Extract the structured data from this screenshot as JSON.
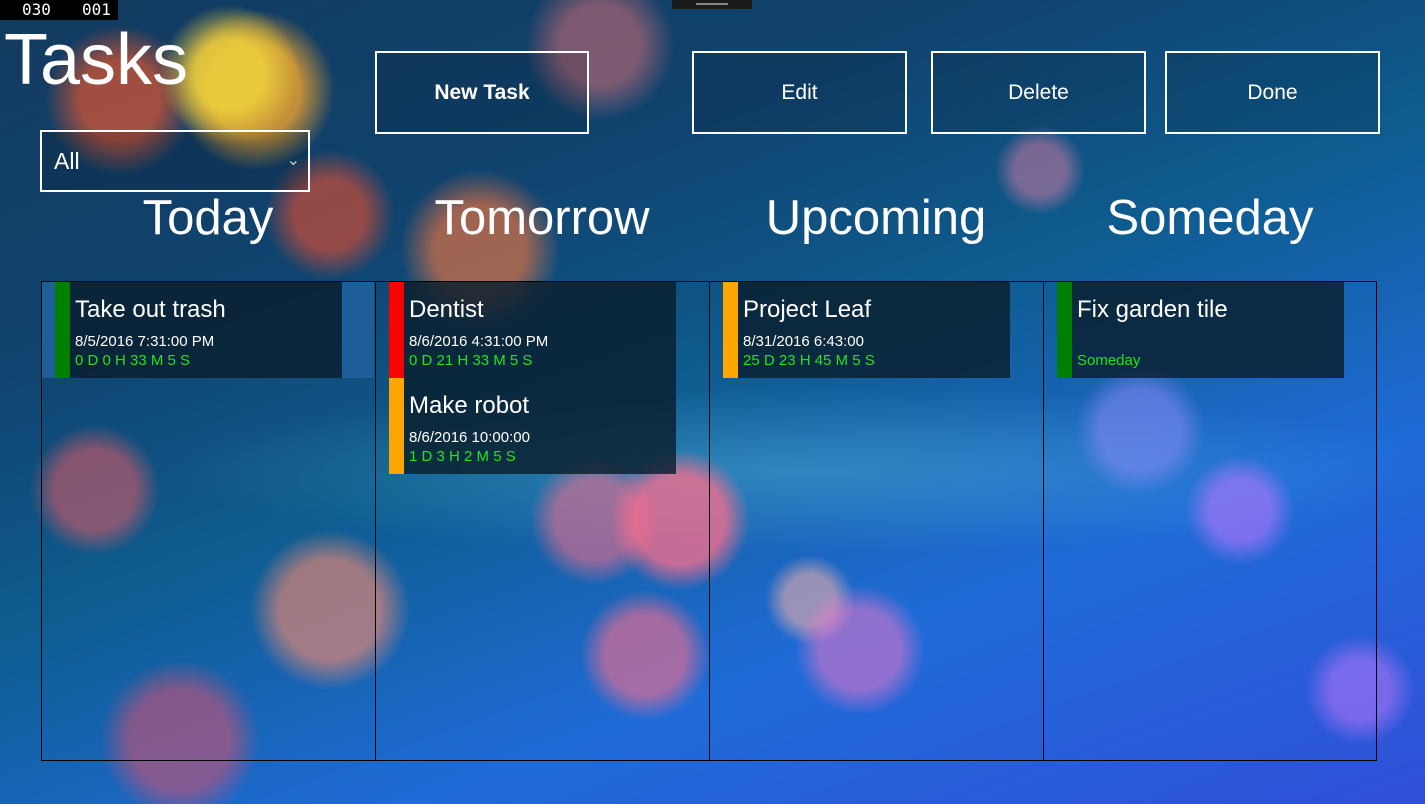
{
  "debug": {
    "counter_left": "030",
    "counter_right": "001"
  },
  "header": {
    "title": "Tasks"
  },
  "toolbar": {
    "new_task_label": "New Task",
    "edit_label": "Edit",
    "delete_label": "Delete",
    "done_label": "Done"
  },
  "filter": {
    "selected": "All"
  },
  "columns": [
    {
      "title": "Today",
      "tasks": [
        {
          "name": "Take out trash",
          "date": "8/5/2016 7:31:00 PM",
          "remaining": "0 D 0 H 33 M 5 S",
          "priority_color": "#008000",
          "selected": true
        }
      ]
    },
    {
      "title": "Tomorrow",
      "tasks": [
        {
          "name": "Dentist",
          "date": "8/6/2016 4:31:00 PM",
          "remaining": "0 D 21 H 33 M 5 S",
          "priority_color": "#ff0000"
        },
        {
          "name": "Make robot",
          "date": "8/6/2016 10:00:00",
          "remaining": "1 D 3 H 2 M 5 S",
          "priority_color": "#ffa500"
        }
      ]
    },
    {
      "title": "Upcoming",
      "tasks": [
        {
          "name": "Project Leaf",
          "date": "8/31/2016 6:43:00",
          "remaining": "25 D 23 H 45 M 5 S",
          "priority_color": "#ffa500"
        }
      ]
    },
    {
      "title": "Someday",
      "tasks": [
        {
          "name": "Fix garden tile",
          "date": "",
          "remaining": "Someday",
          "priority_color": "#008000"
        }
      ]
    }
  ],
  "colors": {
    "remaining_text": "#22e022",
    "selection_accent": "#1f5f99"
  },
  "icons": {
    "filter_dropdown": "chevron-down-icon"
  }
}
